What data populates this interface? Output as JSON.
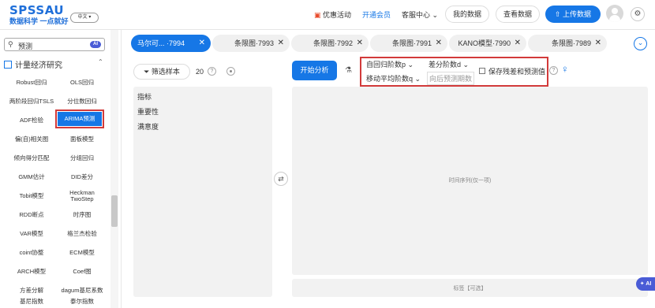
{
  "header": {
    "logo": "SPSSAU",
    "slogan": "数据科学 一点就好",
    "lang": "中文",
    "promo": "优惠活动",
    "vip": "开通会员",
    "service": "客服中心",
    "my_data": "我的数据",
    "view_data": "查看数据",
    "upload": "上传数据"
  },
  "sidebar": {
    "search_value": "预测",
    "search_ai": "AI",
    "section_title": "计量经济研究",
    "items": [
      "Robust回归",
      "OLS回归",
      "两阶段回归TSLS",
      "分位数回归",
      "ADF检验",
      "ARIMA预测",
      "偏(自)相关图",
      "面板模型",
      "倾向得分匹配",
      "分组回归",
      "GMM估计",
      "DID差分",
      "Tobit模型",
      "Heckman TwoStep",
      "RDD断点",
      "时序图",
      "VAR模型",
      "格兰杰检验",
      "coint协整",
      "ECM模型",
      "ARCH模型",
      "Coef图",
      "方差分解",
      "dagum基尼系数",
      "基尼指数",
      "泰尔指数"
    ],
    "active_item": "ARIMA预测"
  },
  "tabs": [
    {
      "label": "马尔可... ·7994",
      "active": true
    },
    {
      "label": "条限图·7993",
      "active": false
    },
    {
      "label": "条限图·7992",
      "active": false
    },
    {
      "label": "条限图·7991",
      "active": false
    },
    {
      "label": "KANO模型·7990",
      "active": false
    },
    {
      "label": "条限图·7989",
      "active": false
    }
  ],
  "left_panel": {
    "filter_label": "筛选样本",
    "sample_count": "20",
    "variables": [
      "指标",
      "重要性",
      "满意度"
    ]
  },
  "right_panel": {
    "start_label": "开始分析",
    "ar_order": "自回归阶数p",
    "diff_order": "差分阶数d",
    "ma_order": "移动平均阶数q",
    "forecast_periods_placeholder": "向后预测期数",
    "save_residuals_label": "保存残差和预测值",
    "timeseries_drop_label": "时间序列(仅一项)",
    "label_drop_label": "标签【可选】",
    "ai_float": "AI"
  }
}
